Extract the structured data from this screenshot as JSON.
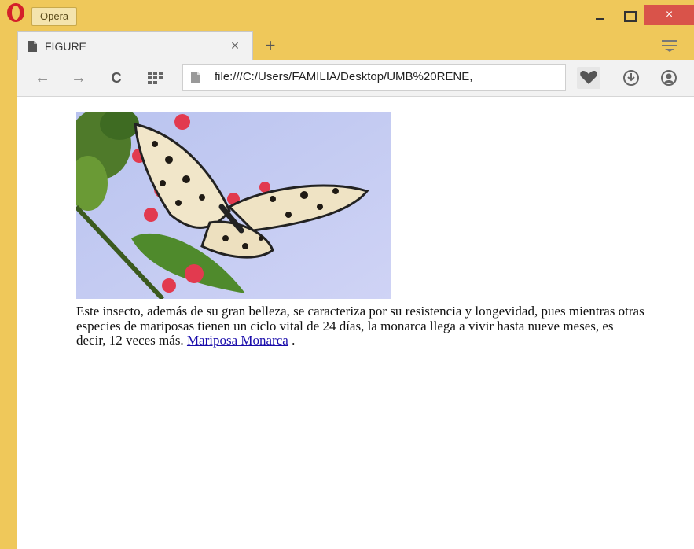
{
  "window": {
    "app_menu_label": "Opera",
    "close_glyph": "×"
  },
  "tab": {
    "title": "FIGURE",
    "close_glyph": "×",
    "new_tab_glyph": "+"
  },
  "toolbar": {
    "back_glyph": "←",
    "forward_glyph": "→",
    "reload_glyph": "C",
    "url": "file:///C:/Users/FAMILIA/Desktop/UMB%20RENE,"
  },
  "figure": {
    "caption_text": "Este insecto, además de su gran belleza, se caracteriza por su resistencia y longevidad, pues mientras otras especies de mariposas tienen un ciclo vital de 24 días, la monarca llega a vivir hasta nueve meses, es decir, 12 veces más. ",
    "link_text": "Mariposa Monarca",
    "trailing_text": " ."
  },
  "icons": [
    "opera-logo-icon",
    "page-icon",
    "close-icon",
    "plus-icon",
    "tab-menu-icon",
    "back-icon",
    "forward-icon",
    "reload-icon",
    "speed-dial-icon",
    "document-icon",
    "heart-icon",
    "download-icon",
    "account-icon",
    "minimize-icon",
    "maximize-icon"
  ]
}
